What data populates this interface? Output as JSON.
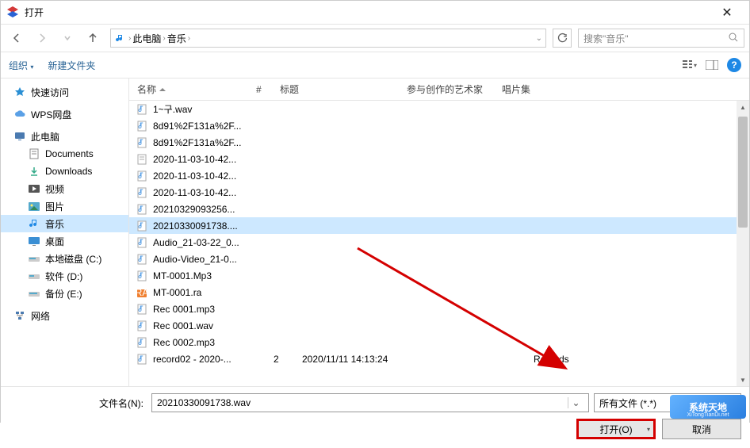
{
  "window": {
    "title": "打开",
    "close": "✕"
  },
  "nav": {
    "breadcrumb": [
      "此电脑",
      "音乐"
    ],
    "search_placeholder": "搜索\"音乐\""
  },
  "toolbar": {
    "organize": "组织",
    "newfolder": "新建文件夹"
  },
  "sidebar": {
    "quick": "快速访问",
    "wps": "WPS网盘",
    "thispc": "此电脑",
    "documents": "Documents",
    "downloads": "Downloads",
    "videos": "视频",
    "pictures": "图片",
    "music": "音乐",
    "desktop": "桌面",
    "diskC": "本地磁盘 (C:)",
    "diskD": "软件 (D:)",
    "diskE": "备份 (E:)",
    "network": "网络"
  },
  "columns": {
    "name": "名称",
    "number": "#",
    "title": "标题",
    "artist": "参与创作的艺术家",
    "album": "唱片集"
  },
  "files": [
    {
      "name": "1~구.wav",
      "icon": "audio",
      "sel": false
    },
    {
      "name": "8d91%2F131a%2F...",
      "icon": "audio",
      "sel": false
    },
    {
      "name": "8d91%2F131a%2F...",
      "icon": "audio",
      "sel": false
    },
    {
      "name": "2020-11-03-10-42...",
      "icon": "doc",
      "sel": false
    },
    {
      "name": "2020-11-03-10-42...",
      "icon": "audio",
      "sel": false
    },
    {
      "name": "2020-11-03-10-42...",
      "icon": "audio",
      "sel": false
    },
    {
      "name": "20210329093256...",
      "icon": "audio",
      "sel": false
    },
    {
      "name": "20210330091738....",
      "icon": "audio",
      "sel": true
    },
    {
      "name": "Audio_21-03-22_0...",
      "icon": "audio",
      "sel": false
    },
    {
      "name": "Audio-Video_21-0...",
      "icon": "audio",
      "sel": false
    },
    {
      "name": "MT-0001.Mp3",
      "icon": "audio",
      "sel": false
    },
    {
      "name": "MT-0001.ra",
      "icon": "ra",
      "sel": false
    },
    {
      "name": "Rec 0001.mp3",
      "icon": "audio",
      "sel": false
    },
    {
      "name": "Rec 0001.wav",
      "icon": "audio",
      "sel": false
    },
    {
      "name": "Rec 0002.mp3",
      "icon": "audio",
      "sel": false
    },
    {
      "name": "record02 - 2020-...",
      "icon": "audio",
      "sel": false,
      "num": "2",
      "title": "2020/11/11 14:13:24",
      "album": "Records"
    }
  ],
  "footer": {
    "filename_label": "文件名(N):",
    "filename_value": "20210330091738.wav",
    "filter": "所有文件 (*.*)",
    "open_btn": "打开(O)",
    "cancel_btn": "取消"
  },
  "watermark": {
    "title": "系统天地",
    "url": "XiTongTianDi.net"
  }
}
